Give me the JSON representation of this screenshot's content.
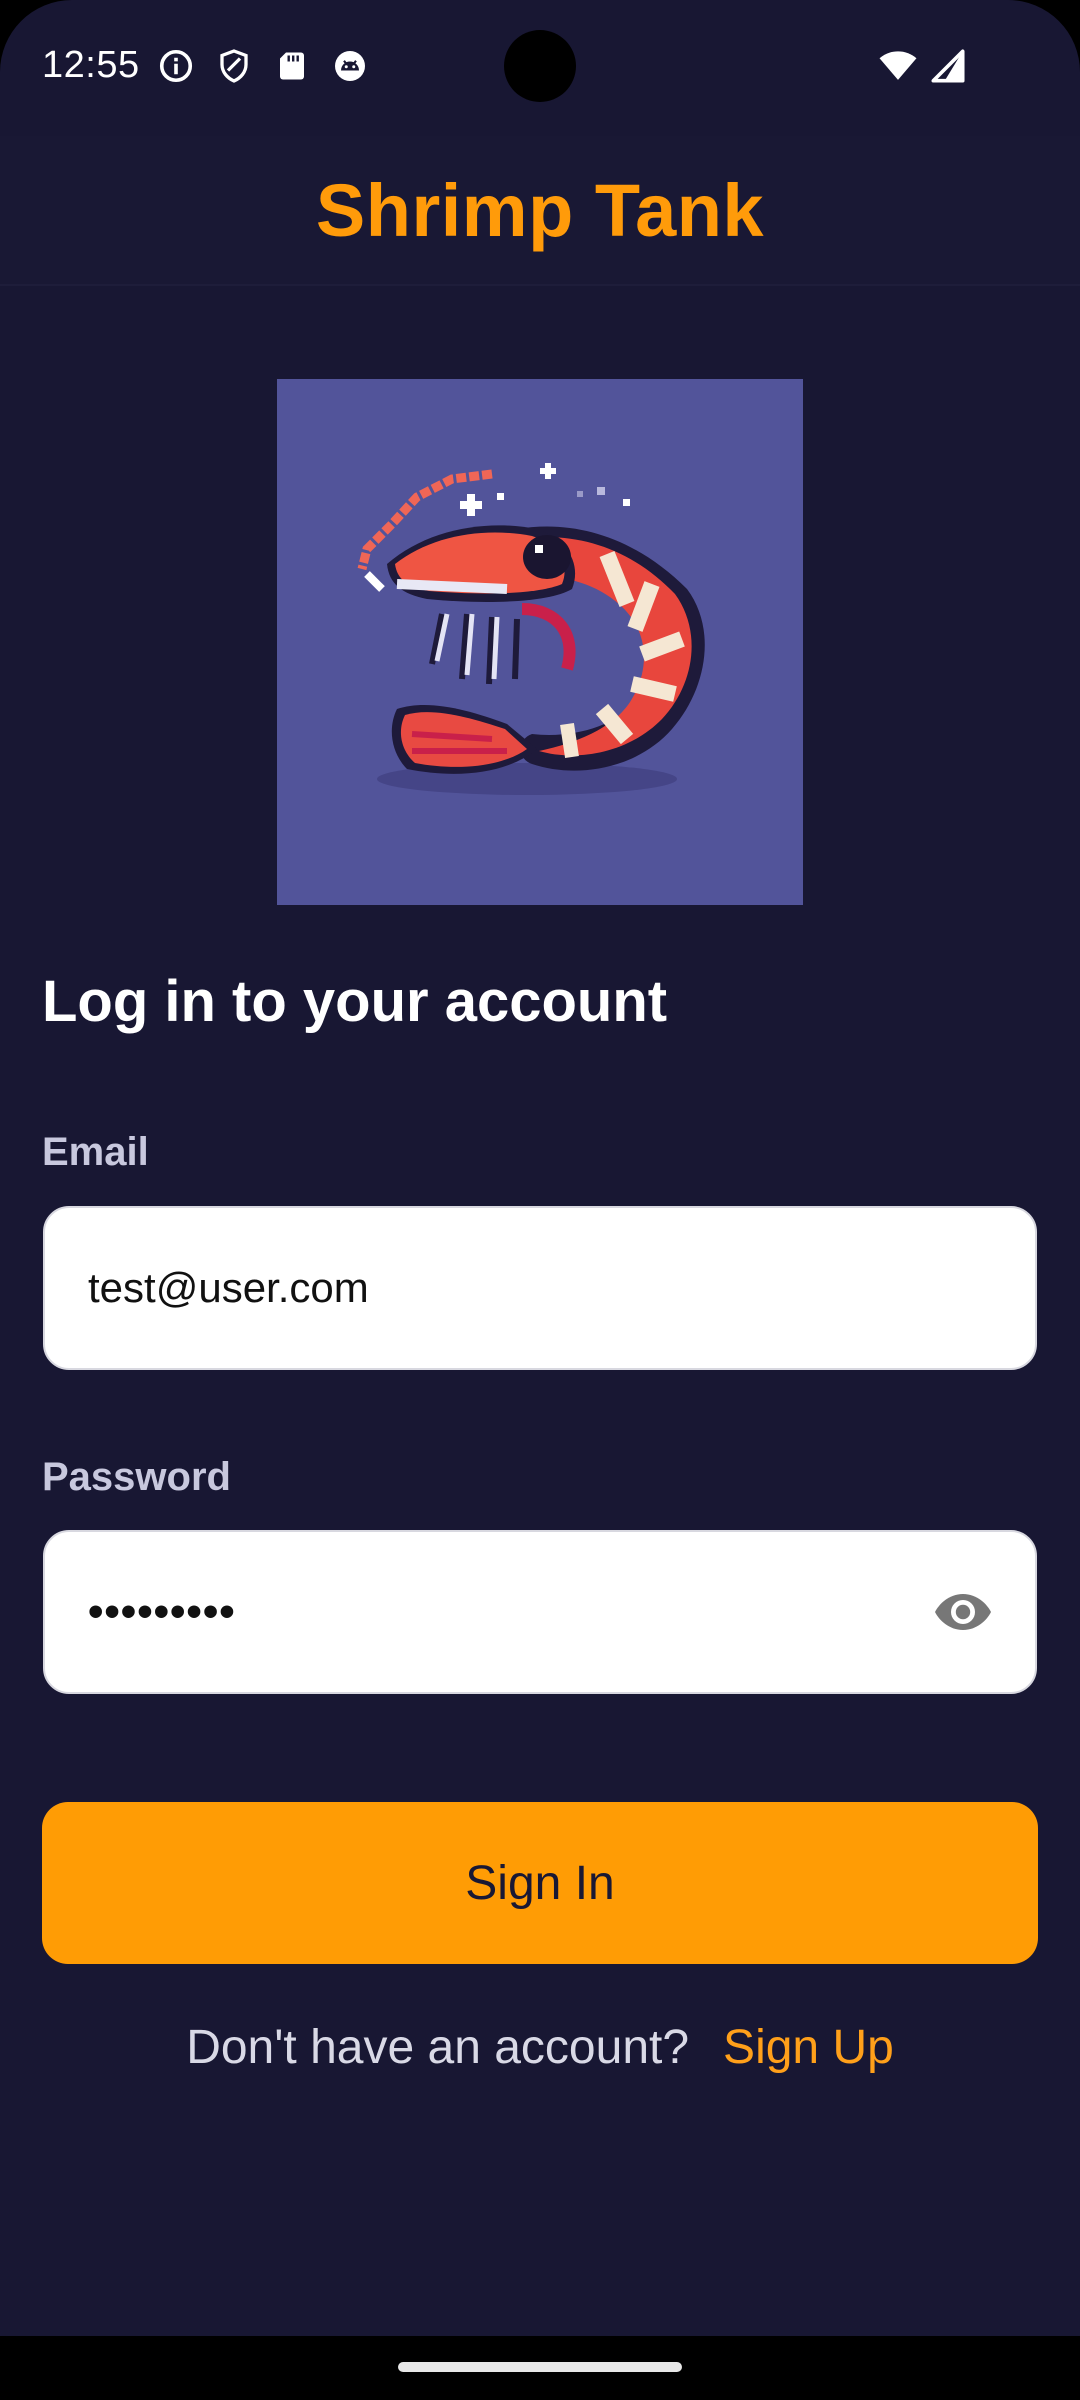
{
  "status_bar": {
    "time": "12:55",
    "left_icons": [
      "info-icon",
      "shield-icon",
      "sd-card-icon",
      "android-icon"
    ],
    "right_icons": [
      "wifi-icon",
      "cell-signal-icon"
    ]
  },
  "app_bar": {
    "title": "Shrimp Tank"
  },
  "logo": {
    "description_icon": "shrimp-pixel-art-icon",
    "background": "#52549a"
  },
  "login": {
    "heading": "Log in to your account",
    "email_label": "Email",
    "email_value": "test@user.com",
    "password_label": "Password",
    "password_value": "•••••••••",
    "toggle_icon": "eye-icon",
    "submit_label": "Sign In",
    "signup_prompt": "Don't have an account?",
    "signup_link": "Sign Up"
  },
  "colors": {
    "background": "#181733",
    "accent": "#ff9c05",
    "heading_text": "#ffffff",
    "label_text": "#c8c8de"
  }
}
